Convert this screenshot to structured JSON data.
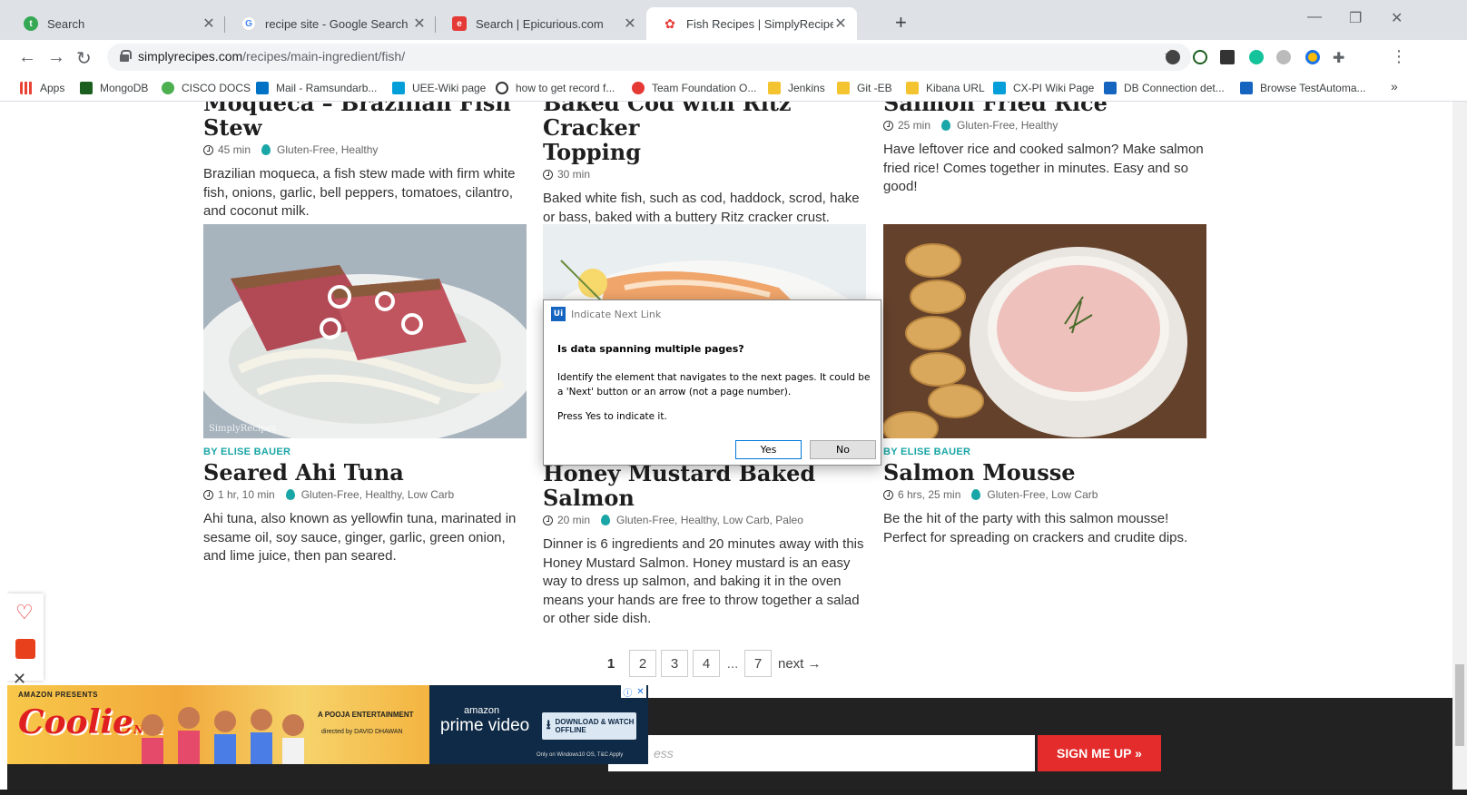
{
  "browser": {
    "tabs": [
      {
        "title": "Search",
        "icon_color": "#34a853"
      },
      {
        "title": "recipe site - Google Search",
        "icon_color": "#ffffff"
      },
      {
        "title": "Search | Epicurious.com",
        "icon_color": "#e53935"
      },
      {
        "title": "Fish Recipes | SimplyRecipes.com",
        "icon_color": "#e53935"
      }
    ],
    "new_tab": "+",
    "url_domain": "simplyrecipes.com",
    "url_path": "/recipes/main-ingredient/fish/",
    "bookmarks": [
      {
        "label": "Apps",
        "icon_color": "#ea4335"
      },
      {
        "label": "MongoDB",
        "icon_color": "#1b5e20"
      },
      {
        "label": "CISCO DOCS",
        "icon_color": "#4caf50"
      },
      {
        "label": "Mail - Ramsundarb...",
        "icon_color": "#0072c6"
      },
      {
        "label": "UEE-Wiki page",
        "icon_color": "#049fd9"
      },
      {
        "label": "how to get record f...",
        "icon_color": "#333333"
      },
      {
        "label": "Team Foundation O...",
        "icon_color": "#e53935"
      },
      {
        "label": "Jenkins",
        "icon_color": "#f4c430"
      },
      {
        "label": "Git -EB",
        "icon_color": "#f4c430"
      },
      {
        "label": "Kibana URL",
        "icon_color": "#f4c430"
      },
      {
        "label": "CX-PI Wiki Page",
        "icon_color": "#049fd9"
      },
      {
        "label": "DB Connection det...",
        "icon_color": "#1565c0"
      },
      {
        "label": "Browse TestAutoma...",
        "icon_color": "#1565c0"
      }
    ],
    "bookmarks_more": "»"
  },
  "recipes_top": [
    {
      "title": "Moqueca – Brazilian Fish Stew",
      "time": "45 min",
      "tags": "Gluten-Free, Healthy",
      "desc": "Brazilian moqueca, a fish stew made with firm white fish, onions, garlic, bell peppers, tomatoes, cilantro, and coconut milk."
    },
    {
      "title_line1": "Baked Cod with Ritz Cracker",
      "title_line2": "Topping",
      "time": "30 min",
      "desc": "Baked white fish, such as cod, haddock, scrod, hake or bass, baked with a buttery Ritz cracker crust."
    },
    {
      "title": "Salmon Fried Rice",
      "time": "25 min",
      "tags": "Gluten-Free, Healthy",
      "desc": "Have leftover rice and cooked salmon? Make salmon fried rice! Comes together in minutes. Easy and so good!"
    }
  ],
  "recipes_bottom": [
    {
      "author": "BY ELISE BAUER",
      "title": "Seared Ahi Tuna",
      "time": "1 hr, 10 min",
      "tags": "Gluten-Free, Healthy, Low Carb",
      "desc": "Ahi tuna, also known as yellowfin tuna, marinated in sesame oil, soy sauce, ginger, garlic, green onion, and lime juice, then pan seared.",
      "watermark": "SimplyRecipes"
    },
    {
      "title": "Honey Mustard Baked Salmon",
      "time": "20 min",
      "tags": "Gluten-Free, Healthy, Low Carb, Paleo",
      "desc": "Dinner is 6 ingredients and 20 minutes away with this Honey Mustard Salmon. Honey mustard is an easy way to dress up salmon, and baking it in the oven means your hands are free to throw together a salad or other side dish."
    },
    {
      "author": "BY ELISE BAUER",
      "title": "Salmon Mousse",
      "time": "6 hrs, 25 min",
      "tags": "Gluten-Free, Low Carb",
      "desc": "Be the hit of the party with this salmon mousse! Perfect for spreading on crackers and crudite dips."
    }
  ],
  "pagination": {
    "current": "1",
    "pages": [
      "2",
      "3",
      "4"
    ],
    "ellipsis": "...",
    "last": "7",
    "next": "next →"
  },
  "newsletter": {
    "email_placeholder": "ess",
    "signup": "SIGN ME UP »"
  },
  "ad": {
    "presents": "AMAZON PRESENTS",
    "movie": "Coolie",
    "movie_no": "NO.1",
    "pooja": "A POOJA ENTERTAINMENT",
    "director": "directed by DAVID DHAWAN",
    "amazon": "amazon",
    "prime": "prime video",
    "download": "DOWNLOAD & WATCH OFFLINE",
    "fine_print": "Only on Windows10 OS, T&C Apply"
  },
  "dialog": {
    "logo": "Ui",
    "title": "Indicate Next Link",
    "question": "Is data spanning multiple pages?",
    "body": "Identify the element that navigates to the next pages. It could be a 'Next' button or an arrow (not a page number).",
    "press": "Press Yes to indicate it.",
    "yes": "Yes",
    "no": "No"
  },
  "colors": {
    "accent_teal": "#1aa6a6",
    "signup_red": "#e42c2c",
    "uipath_blue": "#1565c0"
  }
}
